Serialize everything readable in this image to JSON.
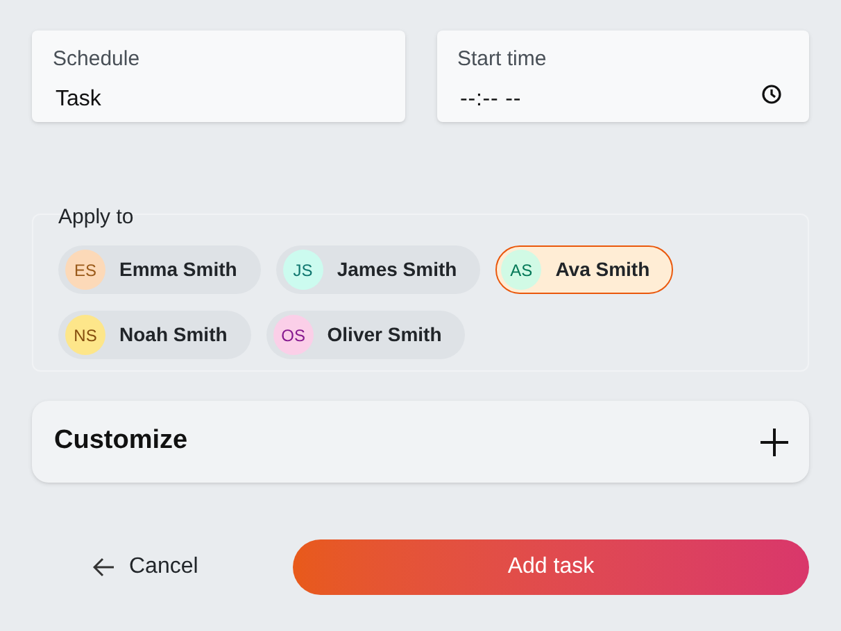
{
  "fields": [
    {
      "label": "Schedule",
      "value": "Task",
      "kind": "text"
    },
    {
      "label": "Start time",
      "value": "--:-- --",
      "kind": "time"
    }
  ],
  "apply_to": {
    "label": "Apply to",
    "people": [
      {
        "initials": "ES",
        "name": "Emma Smith",
        "color": "#fcd9b8",
        "selected": false
      },
      {
        "initials": "JS",
        "name": "James Smith",
        "color": "#ccfbef",
        "selected": false
      },
      {
        "initials": "AS",
        "name": "Ava Smith",
        "color": "#d1fae5",
        "selected": true
      },
      {
        "initials": "NS",
        "name": "Noah Smith",
        "color": "#fde68a",
        "selected": false
      },
      {
        "initials": "OS",
        "name": "Oliver Smith",
        "color": "#fbcfe8",
        "selected": false
      }
    ]
  },
  "customize": {
    "title": "Customize",
    "expanded": false
  },
  "buttons": {
    "cancel": "Cancel",
    "submit": "Add task"
  }
}
